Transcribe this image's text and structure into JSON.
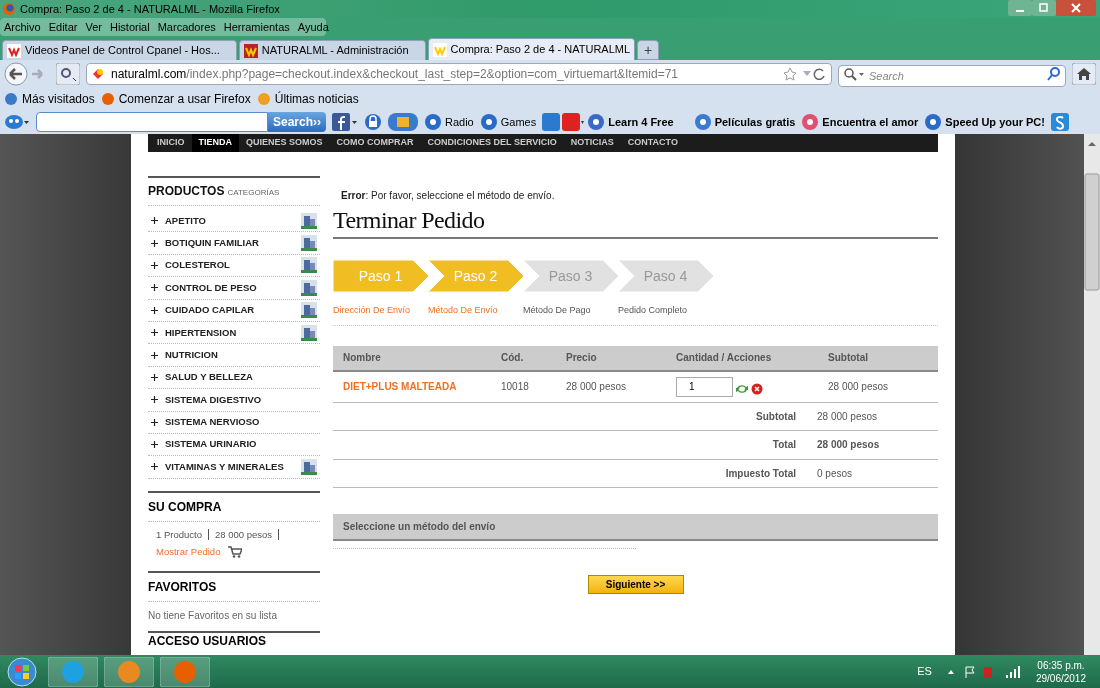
{
  "window": {
    "title": "Compra: Paso 2 de 4 - NATURALML - Mozilla Firefox"
  },
  "menu": [
    "Archivo",
    "Editar",
    "Ver",
    "Historial",
    "Marcadores",
    "Herramientas",
    "Ayuda"
  ],
  "tabs": [
    {
      "label": "Videos Panel de Control Cpanel - Hos...",
      "selected": false
    },
    {
      "label": "NATURALML - Administración",
      "selected": false
    },
    {
      "label": "Compra: Paso 2 de 4 - NATURALML",
      "selected": true
    }
  ],
  "new_tab": "+",
  "address": {
    "host": "naturalml.com",
    "path": "/index.php?page=checkout.index&checkout_last_step=2&option=com_virtuemart&Itemid=71"
  },
  "search": {
    "placeholder": "Search"
  },
  "bookmarks": [
    "Más visitados",
    "Comenzar a usar Firefox",
    "Últimas noticias"
  ],
  "addon_toolbar": {
    "search_button": "Search››",
    "items": [
      "Radio",
      "Games",
      "Learn 4 Free",
      "Películas gratis",
      "Encuentra el amor",
      "Speed Up your PC!"
    ]
  },
  "site_nav": [
    {
      "label": "INICIO",
      "selected": false
    },
    {
      "label": "TIENDA",
      "selected": true
    },
    {
      "label": "QUIENES SOMOS",
      "selected": false
    },
    {
      "label": "COMO COMPRAR",
      "selected": false
    },
    {
      "label": "CONDICIONES DEL SERVICIO",
      "selected": false
    },
    {
      "label": "NOTICIAS",
      "selected": false
    },
    {
      "label": "CONTACTO",
      "selected": false
    }
  ],
  "sidebar": {
    "products_title": "PRODUCTOS",
    "products_subtitle": "CATEGORÍAS",
    "categories": [
      {
        "label": "APETITO",
        "thumbnail": true
      },
      {
        "label": "BOTIQUIN FAMILIAR",
        "thumbnail": true
      },
      {
        "label": "COLESTEROL",
        "thumbnail": true
      },
      {
        "label": "CONTROL DE PESO",
        "thumbnail": true
      },
      {
        "label": "CUIDADO CAPILAR",
        "thumbnail": true
      },
      {
        "label": "HIPERTENSION",
        "thumbnail": true
      },
      {
        "label": "NUTRICION",
        "thumbnail": false
      },
      {
        "label": "SALUD Y BELLEZA",
        "thumbnail": false
      },
      {
        "label": "SISTEMA DIGESTIVO",
        "thumbnail": false
      },
      {
        "label": "SISTEMA NERVIOSO",
        "thumbnail": false
      },
      {
        "label": "SISTEMA URINARIO",
        "thumbnail": false
      },
      {
        "label": "VITAMINAS Y MINERALES",
        "thumbnail": true
      }
    ],
    "cart": {
      "title": "SU COMPRA",
      "count": "1 Producto",
      "total": "28 000 pesos",
      "link": "Mostrar Pedido"
    },
    "favorites": {
      "title": "FAVORITOS",
      "text": "No tiene Favoritos en su lista"
    },
    "login": {
      "title": "ACCESO USUARIOS"
    }
  },
  "main": {
    "error": "**Error**: Por favor, seleccione el método de envío.",
    "title": "Terminar Pedido",
    "steps": [
      {
        "label": "Paso 1",
        "done": true
      },
      {
        "label": "Paso 2",
        "done": true
      },
      {
        "label": "Paso 3",
        "done": false
      },
      {
        "label": "Paso 4",
        "done": false
      }
    ],
    "step_links": [
      {
        "label": "Dirección De Envío",
        "done": true
      },
      {
        "label": "Método De Envío",
        "done": true
      },
      {
        "label": "Método De Pago",
        "done": false
      },
      {
        "label": "Pedido Completo",
        "done": false
      }
    ],
    "table": {
      "columns": [
        "Nombre",
        "Cód.",
        "Precio",
        "Cantidad / Acciones",
        "Subtotal"
      ],
      "rows": [
        {
          "name": "DIET+PLUS MALTEADA",
          "code": "10018",
          "price": "28 000 pesos",
          "quantity": "1",
          "subtotal": "28 000 pesos"
        }
      ],
      "totals": [
        {
          "label": "Subtotal",
          "value": "28 000 pesos",
          "bold": false
        },
        {
          "label": "Total",
          "value": "28 000 pesos",
          "bold": true
        },
        {
          "label": "Impuesto Total",
          "value": "0 pesos",
          "bold": false
        }
      ]
    },
    "shipping_header": "Seleccione un método del envío",
    "next_button": "Siguiente >>"
  },
  "taskbar": {
    "language": "ES",
    "time": "06:35 p.m.",
    "date": "29/06/2012"
  }
}
